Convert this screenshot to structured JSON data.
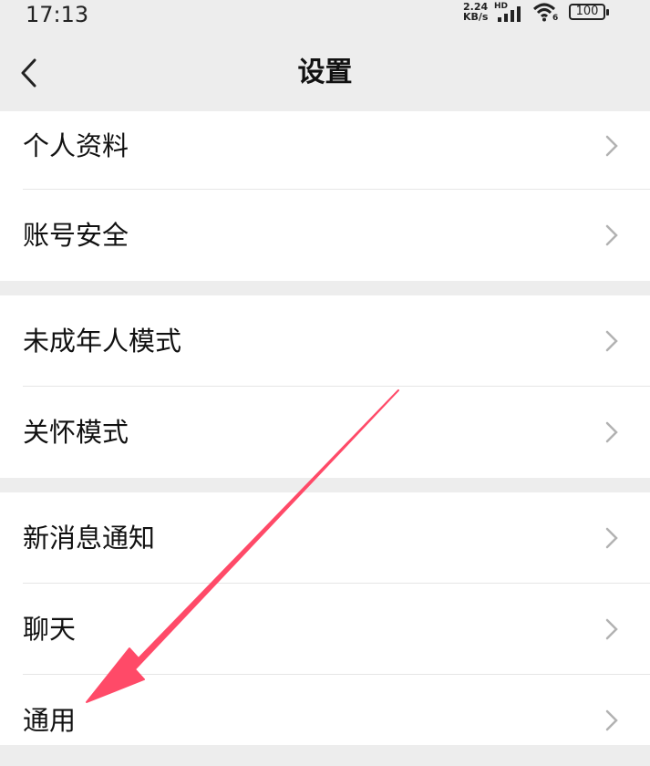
{
  "status_bar": {
    "time": "17:13",
    "net_speed_value": "2.24",
    "net_speed_unit": "KB/s",
    "hd": "HD",
    "wifi_sub": "6",
    "battery": "100"
  },
  "nav": {
    "title": "设置",
    "back_icon": "chevron-left-icon"
  },
  "groups": [
    {
      "items": [
        {
          "label": "个人资料"
        },
        {
          "label": "账号安全"
        }
      ]
    },
    {
      "items": [
        {
          "label": "未成年人模式"
        },
        {
          "label": "关怀模式"
        }
      ]
    },
    {
      "items": [
        {
          "label": "新消息通知"
        },
        {
          "label": "聊天"
        },
        {
          "label": "通用"
        }
      ]
    }
  ],
  "annotation": {
    "arrow_color": "#ff4a68",
    "points_to": "通用"
  },
  "colors": {
    "background": "#ededed",
    "row_background": "#ffffff",
    "chevron": "#b2b2b2"
  }
}
